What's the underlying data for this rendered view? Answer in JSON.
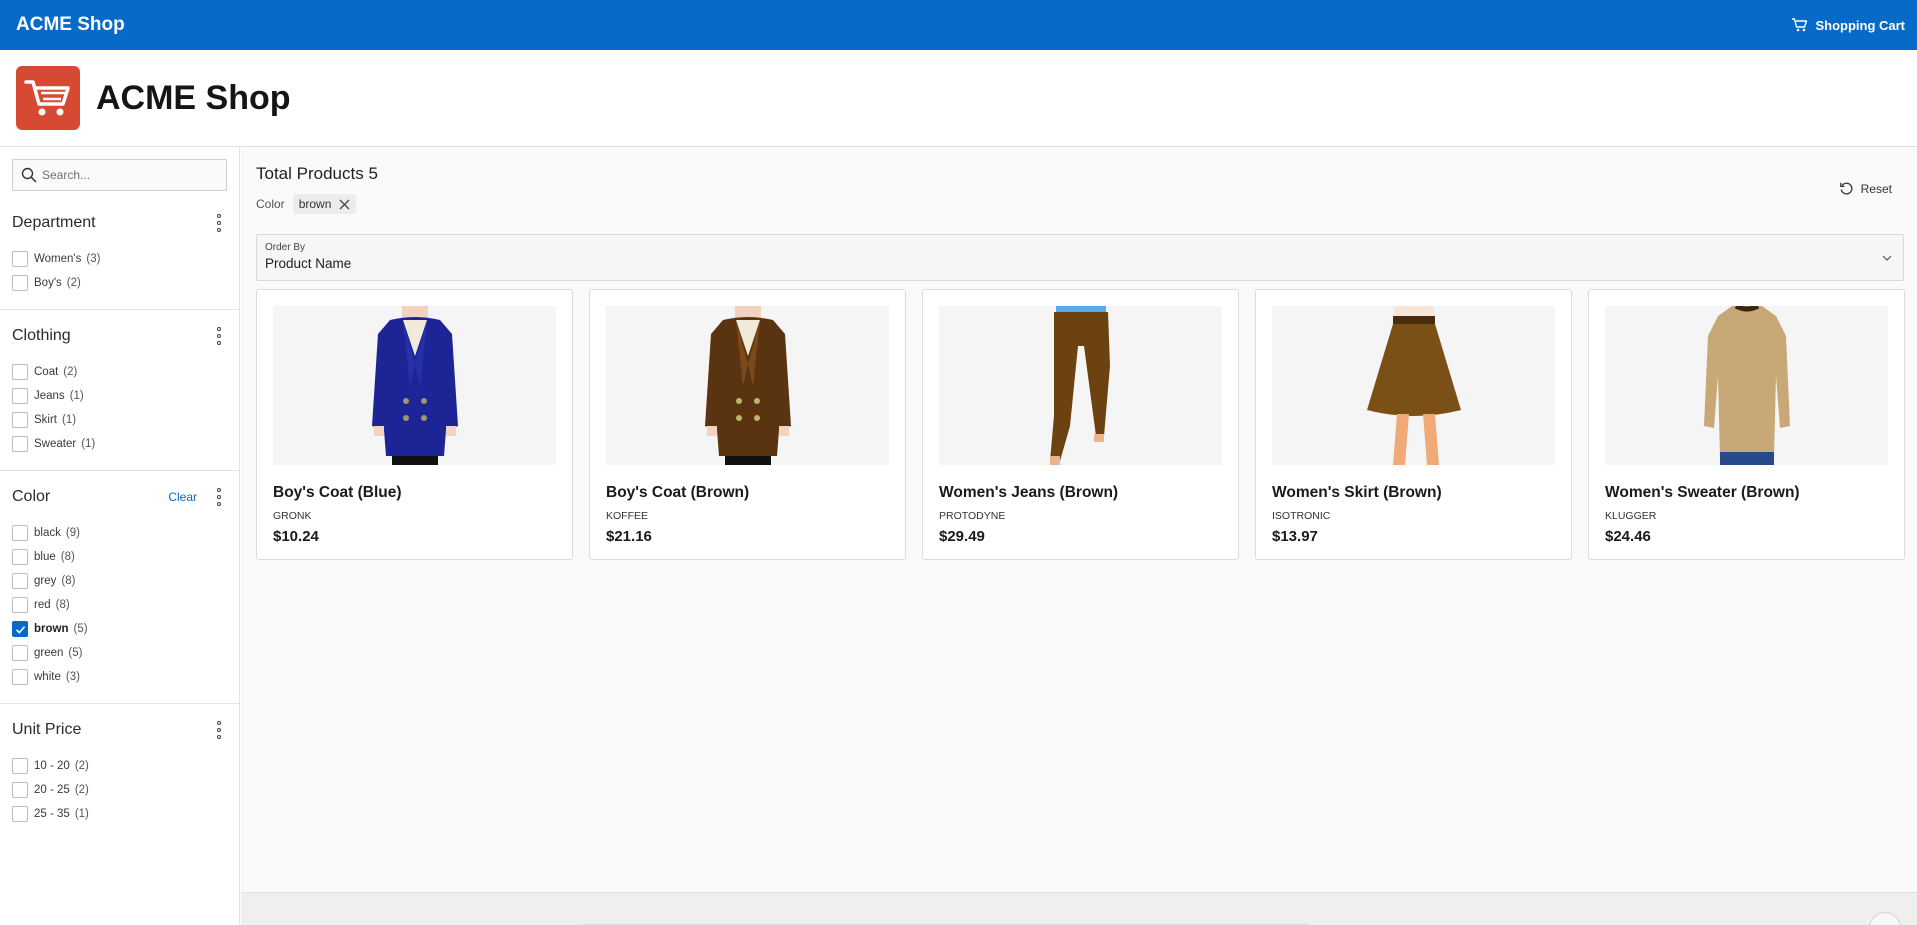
{
  "topbar": {
    "brand": "ACME Shop",
    "cart_label": "Shopping Cart"
  },
  "hero": {
    "title": "ACME Shop",
    "logo_icon": "shopping-cart-icon",
    "logo_color": "#d64a33"
  },
  "search": {
    "placeholder": "Search..."
  },
  "facets": {
    "department": {
      "title": "Department",
      "options": [
        {
          "label": "Women's",
          "count": "(3)",
          "checked": false
        },
        {
          "label": "Boy's",
          "count": "(2)",
          "checked": false
        }
      ]
    },
    "clothing": {
      "title": "Clothing",
      "options": [
        {
          "label": "Coat",
          "count": "(2)",
          "checked": false
        },
        {
          "label": "Jeans",
          "count": "(1)",
          "checked": false
        },
        {
          "label": "Skirt",
          "count": "(1)",
          "checked": false
        },
        {
          "label": "Sweater",
          "count": "(1)",
          "checked": false
        }
      ]
    },
    "color": {
      "title": "Color",
      "clear_label": "Clear",
      "options": [
        {
          "label": "black",
          "count": "(9)",
          "checked": false
        },
        {
          "label": "blue",
          "count": "(8)",
          "checked": false
        },
        {
          "label": "grey",
          "count": "(8)",
          "checked": false
        },
        {
          "label": "red",
          "count": "(8)",
          "checked": false
        },
        {
          "label": "brown",
          "count": "(5)",
          "checked": true
        },
        {
          "label": "green",
          "count": "(5)",
          "checked": false
        },
        {
          "label": "white",
          "count": "(3)",
          "checked": false
        }
      ]
    },
    "unit_price": {
      "title": "Unit Price",
      "options": [
        {
          "label": "10 - 20",
          "count": "(2)",
          "checked": false
        },
        {
          "label": "20 - 25",
          "count": "(2)",
          "checked": false
        },
        {
          "label": "25 - 35",
          "count": "(1)",
          "checked": false
        }
      ]
    }
  },
  "results": {
    "total_label": "Total Products 5",
    "active_filter": {
      "facet": "Color",
      "value": "brown"
    },
    "reset_label": "Reset",
    "order_by": {
      "label": "Order By",
      "value": "Product Name"
    }
  },
  "products": [
    {
      "name": "Boy's Coat (Blue)",
      "vendor": "GRONK",
      "price": "$10.24",
      "image": "coat-blue"
    },
    {
      "name": "Boy's Coat (Brown)",
      "vendor": "KOFFEE",
      "price": "$21.16",
      "image": "coat-brown"
    },
    {
      "name": "Women's Jeans (Brown)",
      "vendor": "PROTODYNE",
      "price": "$29.49",
      "image": "jeans-brown"
    },
    {
      "name": "Women's Skirt (Brown)",
      "vendor": "ISOTRONIC",
      "price": "$13.97",
      "image": "skirt-brown"
    },
    {
      "name": "Women's Sweater (Brown)",
      "vendor": "KLUGGER",
      "price": "$24.46",
      "image": "sweater-brown"
    }
  ],
  "colors": {
    "header": "#056ac8",
    "accent": "#056ac8"
  }
}
